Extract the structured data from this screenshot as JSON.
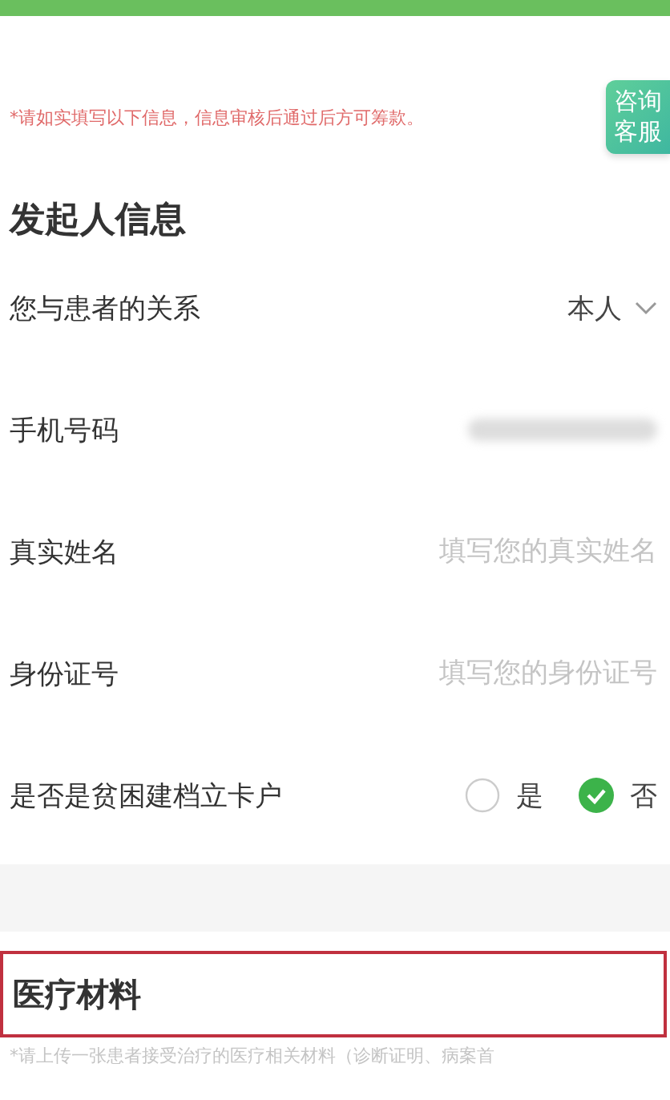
{
  "notice": "*请如实填写以下信息，信息审核后通过后方可筹款。",
  "consult_button": [
    "咨询",
    "客服"
  ],
  "section_title": "发起人信息",
  "rows": [
    {
      "kind": "select",
      "label": "您与患者的关系",
      "value": "本人"
    },
    {
      "kind": "redacted",
      "label": "手机号码"
    },
    {
      "kind": "input",
      "label": "真实姓名",
      "placeholder": "填写您的真实姓名"
    },
    {
      "kind": "input",
      "label": "身份证号",
      "placeholder": "填写您的身份证号"
    },
    {
      "kind": "radio",
      "label": "是否是贫困建档立卡户",
      "options": [
        {
          "label": "是",
          "selected": false
        },
        {
          "label": "否",
          "selected": true
        }
      ]
    }
  ],
  "medical": {
    "title": "医疗材料",
    "highlighted": true,
    "note": "*请上传一张患者接受治疗的医疗相关材料（诊断证明、病案首"
  }
}
